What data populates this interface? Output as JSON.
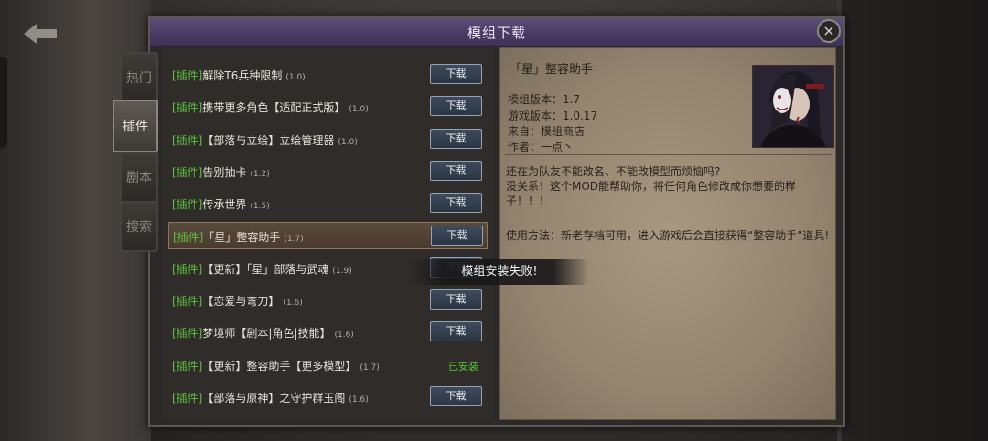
{
  "dialog": {
    "title": "模组下载",
    "close_label": "×"
  },
  "tabs": [
    {
      "label": "热门",
      "active": false
    },
    {
      "label": "插件",
      "active": true
    },
    {
      "label": "剧本",
      "active": false
    },
    {
      "label": "搜索",
      "active": false
    }
  ],
  "mods": [
    {
      "tag": "[插件]",
      "name": "解除T6兵种限制",
      "version": "(1.0)",
      "action": "下载"
    },
    {
      "tag": "[插件]",
      "name": "携带更多角色【适配正式版】",
      "version": "(1.0)",
      "action": "下载"
    },
    {
      "tag": "[插件]",
      "name": "【部落与立绘】立绘管理器",
      "version": "(1.0)",
      "action": "下载"
    },
    {
      "tag": "[插件]",
      "name": "告别抽卡",
      "version": "(1.2)",
      "action": "下载"
    },
    {
      "tag": "[插件]",
      "name": "传承世界",
      "version": "(1.5)",
      "action": "下载"
    },
    {
      "tag": "[插件]",
      "name": "「星」整容助手",
      "version": "(1.7)",
      "action": "下载",
      "selected": true
    },
    {
      "tag": "[插件]",
      "name": "【更新】「星」部落与武魂",
      "version": "(1.9)",
      "action": "下载"
    },
    {
      "tag": "[插件]",
      "name": "【恋爱与弯刀】",
      "version": "(1.6)",
      "action": "下载"
    },
    {
      "tag": "[插件]",
      "name": "梦境师【剧本|角色|技能】",
      "version": "(1.6)",
      "action": "下载"
    },
    {
      "tag": "[插件]",
      "name": "【更新】整容助手【更多模型】",
      "version": "(1.7)",
      "action": "已安装"
    },
    {
      "tag": "[插件]",
      "name": "【部落与原神】之守护群玉阁",
      "version": "(1.6)",
      "action": "下载"
    }
  ],
  "toast": "模组安装失败!",
  "detail": {
    "title": "「星」整容助手",
    "mod_version": "模组版本：1.7",
    "game_version": "游戏版本：1.0.17",
    "source": "来自：模组商店",
    "author": "作者：一点丶",
    "desc1": "还在为队友不能改名、不能改模型而烦恼吗?",
    "desc2": "没关系！这个MOD能帮助你，将任何角色修改成你想要的样子！！！",
    "usage": "使用方法：新老存档可用，进入游戏后会直接获得“整容助手”道具!"
  }
}
